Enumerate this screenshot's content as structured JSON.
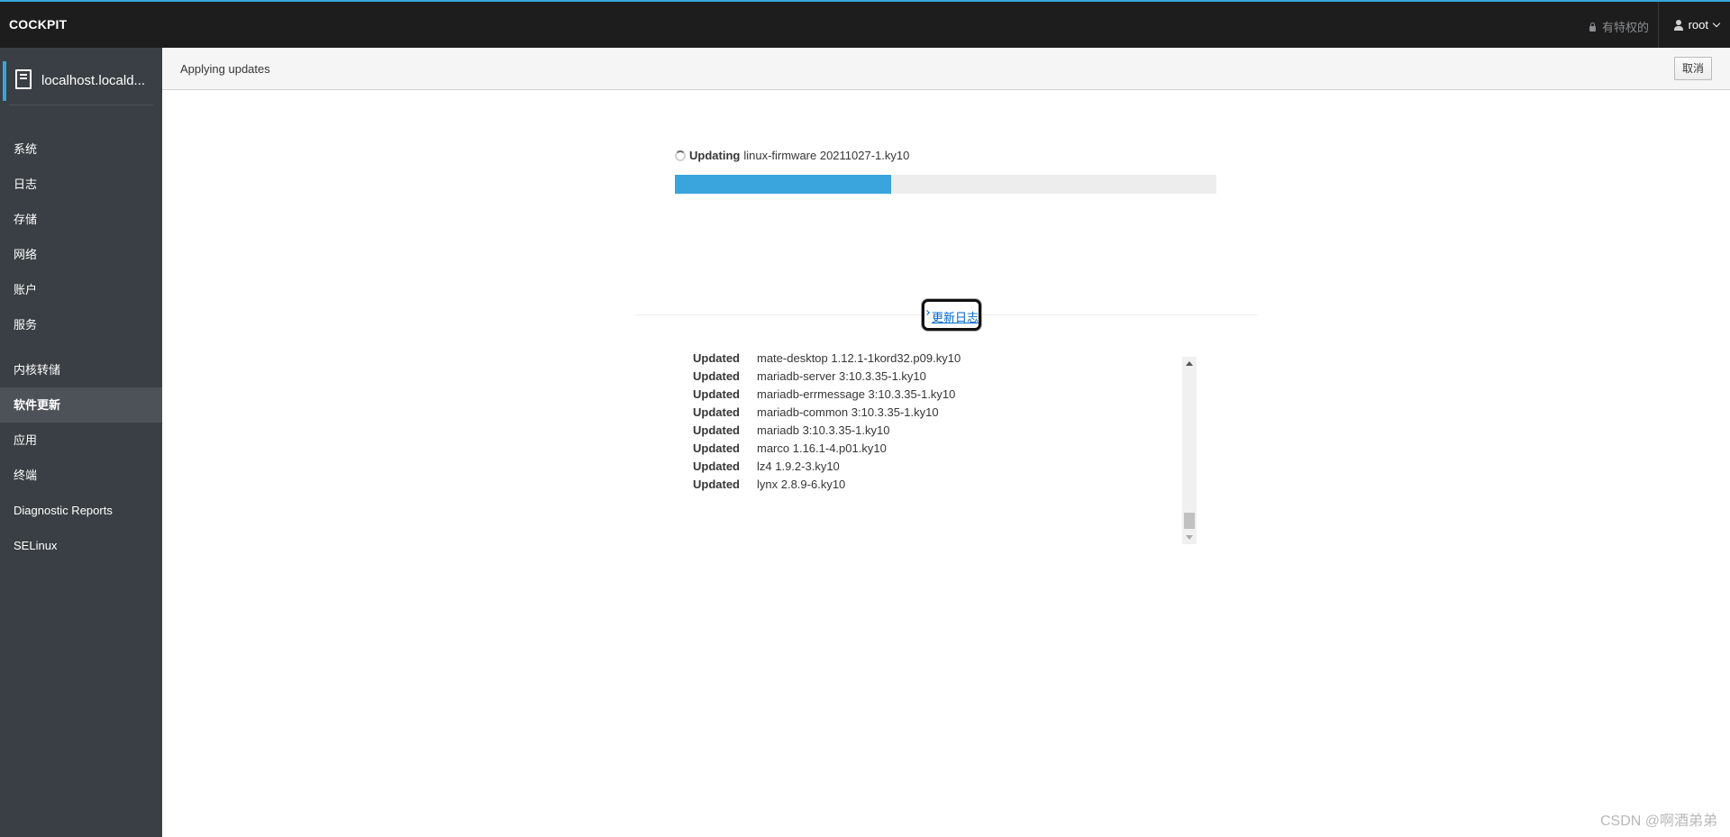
{
  "topbar": {
    "brand": "COCKPIT",
    "privilege_text": "有特权的",
    "user": "root",
    "accent_color": "#39a5dc"
  },
  "sidebar": {
    "host": "localhost.locald...",
    "items": [
      {
        "label": "系统"
      },
      {
        "label": "日志"
      },
      {
        "label": "存储"
      },
      {
        "label": "网络"
      },
      {
        "label": "账户"
      },
      {
        "label": "服务"
      },
      {
        "label": "内核转储"
      },
      {
        "label": "软件更新",
        "active": true
      },
      {
        "label": "应用"
      },
      {
        "label": "终端"
      },
      {
        "label": "Diagnostic Reports"
      },
      {
        "label": "SELinux"
      }
    ]
  },
  "header": {
    "title": "Applying updates",
    "cancel_label": "取消"
  },
  "progress": {
    "status_label": "Updating",
    "package": "linux-firmware 20211027-1.ky10",
    "fraction": 0.4
  },
  "log": {
    "toggle_label": "更新日志",
    "entries": [
      {
        "status": "Updated",
        "package": "mate-desktop 1.12.1-1kord32.p09.ky10"
      },
      {
        "status": "Updated",
        "package": "mariadb-server 3:10.3.35-1.ky10"
      },
      {
        "status": "Updated",
        "package": "mariadb-errmessage 3:10.3.35-1.ky10"
      },
      {
        "status": "Updated",
        "package": "mariadb-common 3:10.3.35-1.ky10"
      },
      {
        "status": "Updated",
        "package": "mariadb 3:10.3.35-1.ky10"
      },
      {
        "status": "Updated",
        "package": "marco 1.16.1-4.p01.ky10"
      },
      {
        "status": "Updated",
        "package": "lz4 1.9.2-3.ky10"
      },
      {
        "status": "Updated",
        "package": "lynx 2.8.9-6.ky10"
      }
    ]
  },
  "watermark": "CSDN @啊酒弟弟"
}
